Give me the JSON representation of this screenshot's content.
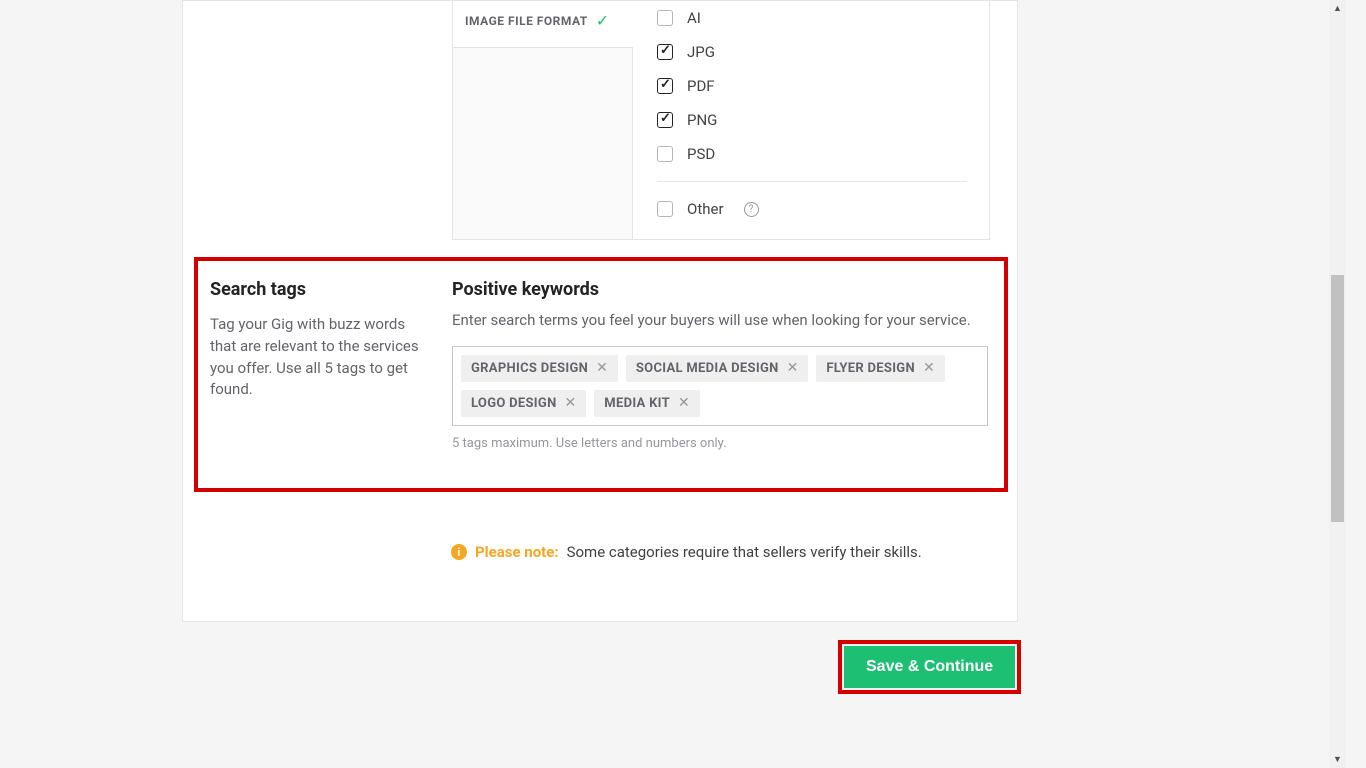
{
  "file_format": {
    "label": "IMAGE FILE FORMAT",
    "options": [
      {
        "label": "AI",
        "checked": false
      },
      {
        "label": "JPG",
        "checked": true
      },
      {
        "label": "PDF",
        "checked": true
      },
      {
        "label": "PNG",
        "checked": true
      },
      {
        "label": "PSD",
        "checked": false
      }
    ],
    "other_label": "Other",
    "other_checked": false
  },
  "search_tags": {
    "heading": "Search tags",
    "description": "Tag your Gig with buzz words that are relevant to the services you offer. Use all 5 tags to get found."
  },
  "positive_keywords": {
    "heading": "Positive keywords",
    "description": "Enter search terms you feel your buyers will use when looking for your service.",
    "tags": [
      "GRAPHICS DESIGN",
      "SOCIAL MEDIA DESIGN",
      "FLYER DESIGN",
      "LOGO DESIGN",
      "MEDIA KIT"
    ],
    "hint": "5 tags maximum. Use letters and numbers only."
  },
  "please_note": {
    "label": "Please note:",
    "text": "Some categories require that sellers verify their skills."
  },
  "save_continue": "Save & Continue"
}
